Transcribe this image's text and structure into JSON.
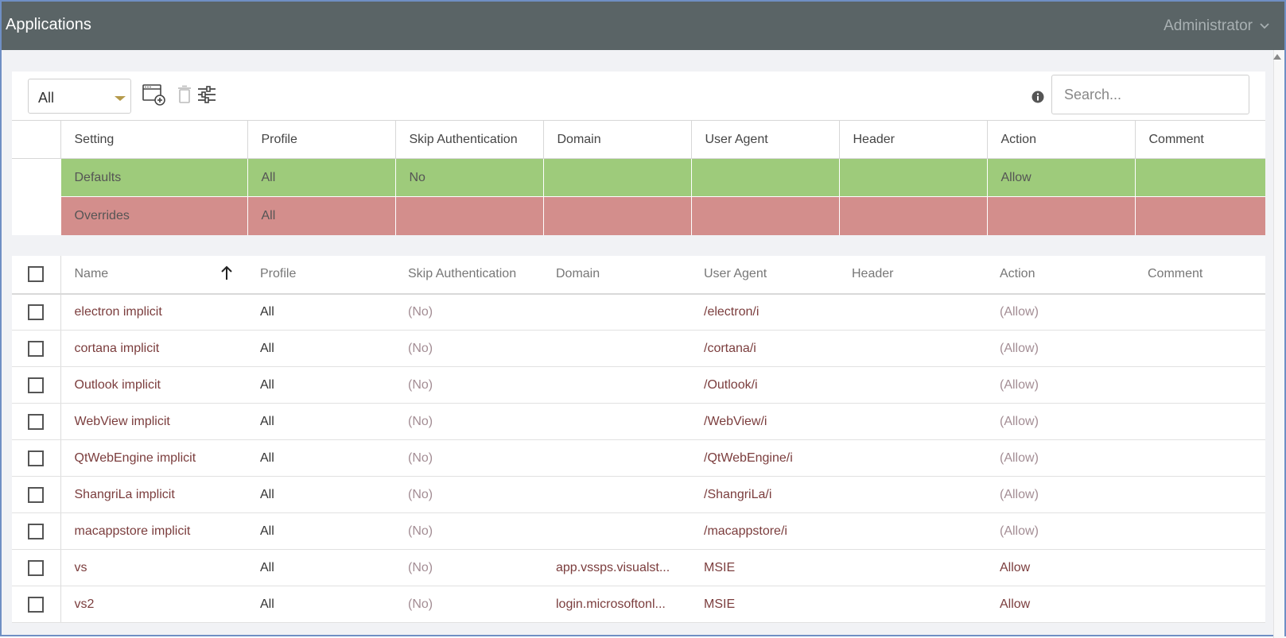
{
  "window": {
    "title": "Applications",
    "user": "Administrator"
  },
  "toolbar": {
    "filter_value": "All",
    "icons": [
      "add-application-icon",
      "delete-icon",
      "settings-sliders-icon",
      "info-icon"
    ],
    "search_placeholder": "Search..."
  },
  "overrides_table": {
    "headers": [
      "Setting",
      "Profile",
      "Skip Authentication",
      "Domain",
      "User Agent",
      "Header",
      "Action",
      "Comment"
    ],
    "rows": [
      {
        "setting": "Defaults",
        "profile": "All",
        "skip_auth": "No",
        "domain": "",
        "user_agent": "",
        "header": "",
        "action": "Allow",
        "comment": ""
      },
      {
        "setting": "Overrides",
        "profile": "All",
        "skip_auth": "",
        "domain": "",
        "user_agent": "",
        "header": "",
        "action": "",
        "comment": ""
      }
    ]
  },
  "apps_table": {
    "headers": [
      "Name",
      "Profile",
      "Skip Authentication",
      "Domain",
      "User Agent",
      "Header",
      "Action",
      "Comment"
    ],
    "sort": "ascending by Name",
    "rows": [
      {
        "name": "electron implicit",
        "profile": "All",
        "skip_auth": "(No)",
        "domain": "",
        "user_agent": "/electron/i",
        "header": "",
        "action": "(Allow)",
        "comment": ""
      },
      {
        "name": "cortana implicit",
        "profile": "All",
        "skip_auth": "(No)",
        "domain": "",
        "user_agent": "/cortana/i",
        "header": "",
        "action": "(Allow)",
        "comment": ""
      },
      {
        "name": "Outlook implicit",
        "profile": "All",
        "skip_auth": "(No)",
        "domain": "",
        "user_agent": "/Outlook/i",
        "header": "",
        "action": "(Allow)",
        "comment": ""
      },
      {
        "name": "WebView implicit",
        "profile": "All",
        "skip_auth": "(No)",
        "domain": "",
        "user_agent": "/WebView/i",
        "header": "",
        "action": "(Allow)",
        "comment": ""
      },
      {
        "name": "QtWebEngine implicit",
        "profile": "All",
        "skip_auth": "(No)",
        "domain": "",
        "user_agent": "/QtWebEngine/i",
        "header": "",
        "action": "(Allow)",
        "comment": ""
      },
      {
        "name": "ShangriLa implicit",
        "profile": "All",
        "skip_auth": "(No)",
        "domain": "",
        "user_agent": "/ShangriLa/i",
        "header": "",
        "action": "(Allow)",
        "comment": ""
      },
      {
        "name": "macappstore implicit",
        "profile": "All",
        "skip_auth": "(No)",
        "domain": "",
        "user_agent": "/macappstore/i",
        "header": "",
        "action": "(Allow)",
        "comment": ""
      },
      {
        "name": "vs",
        "profile": "All",
        "skip_auth": "(No)",
        "domain": "app.vssps.visualst...",
        "user_agent": "MSIE",
        "header": "",
        "action": "Allow",
        "comment": ""
      },
      {
        "name": "vs2",
        "profile": "All",
        "skip_auth": "(No)",
        "domain": "login.microsoftonl...",
        "user_agent": "MSIE",
        "header": "",
        "action": "Allow",
        "comment": ""
      }
    ]
  },
  "colors": {
    "titlebar": "#5a6466",
    "defaults_row": "#9ecb7b",
    "overrides_row": "#d38e8c",
    "link_text": "#7b3d3d"
  }
}
